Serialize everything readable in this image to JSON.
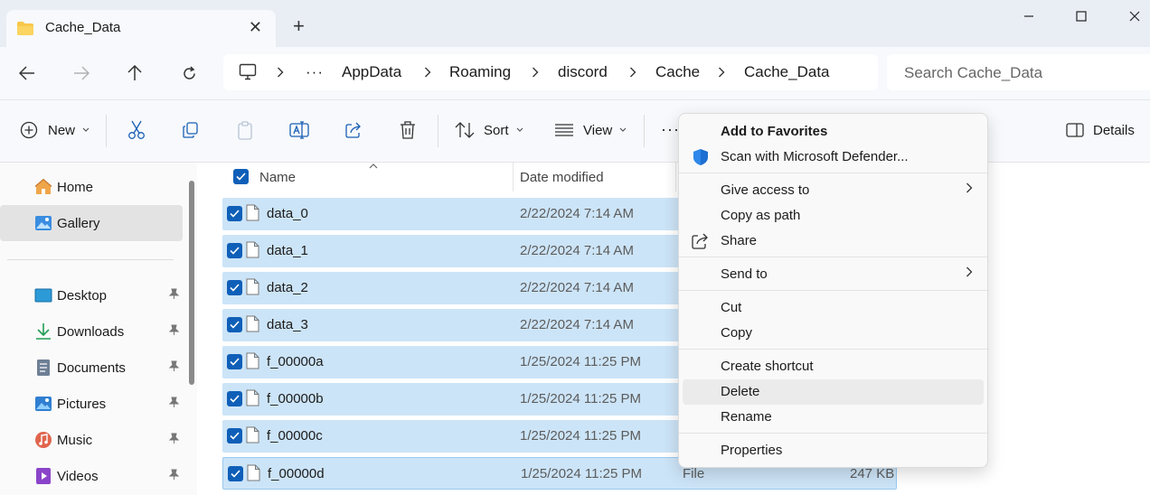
{
  "window": {
    "tab_title": "Cache_Data",
    "new_tab": "+",
    "controls": {
      "minimize": "—",
      "maximize": "☐",
      "close": "✕"
    }
  },
  "breadcrumb": {
    "overflow": "···",
    "items": [
      "AppData",
      "Roaming",
      "discord",
      "Cache",
      "Cache_Data"
    ]
  },
  "search": {
    "placeholder": "Search Cache_Data"
  },
  "toolbar": {
    "new_label": "New",
    "sort_label": "Sort",
    "view_label": "View",
    "more_label": "···",
    "details_label": "Details"
  },
  "nav": {
    "items": [
      {
        "label": "Home",
        "icon": "home-icon",
        "selected": false,
        "pinned": false
      },
      {
        "label": "Gallery",
        "icon": "gallery-icon",
        "selected": true,
        "pinned": false
      },
      {
        "label": "Desktop",
        "icon": "desktop-icon",
        "selected": false,
        "pinned": true
      },
      {
        "label": "Downloads",
        "icon": "download-icon",
        "selected": false,
        "pinned": true
      },
      {
        "label": "Documents",
        "icon": "documents-icon",
        "selected": false,
        "pinned": true
      },
      {
        "label": "Pictures",
        "icon": "pictures-icon",
        "selected": false,
        "pinned": true
      },
      {
        "label": "Music",
        "icon": "music-icon",
        "selected": false,
        "pinned": true
      },
      {
        "label": "Videos",
        "icon": "videos-icon",
        "selected": false,
        "pinned": true
      }
    ]
  },
  "columns": {
    "name": "Name",
    "date": "Date modified"
  },
  "files": [
    {
      "name": "data_0",
      "date": "2/22/2024 7:14 AM",
      "type": "",
      "size": ""
    },
    {
      "name": "data_1",
      "date": "2/22/2024 7:14 AM",
      "type": "",
      "size": ""
    },
    {
      "name": "data_2",
      "date": "2/22/2024 7:14 AM",
      "type": "",
      "size": ""
    },
    {
      "name": "data_3",
      "date": "2/22/2024 7:14 AM",
      "type": "",
      "size": ""
    },
    {
      "name": "f_00000a",
      "date": "1/25/2024 11:25 PM",
      "type": "",
      "size": ""
    },
    {
      "name": "f_00000b",
      "date": "1/25/2024 11:25 PM",
      "type": "",
      "size": ""
    },
    {
      "name": "f_00000c",
      "date": "1/25/2024 11:25 PM",
      "type": "",
      "size": ""
    },
    {
      "name": "f_00000d",
      "date": "1/25/2024 11:25 PM",
      "type": "File",
      "size": "247 KB"
    }
  ],
  "context_menu": {
    "add_favorites": "Add to Favorites",
    "scan_defender": "Scan with Microsoft Defender...",
    "give_access": "Give access to",
    "copy_path": "Copy as path",
    "share": "Share",
    "send_to": "Send to",
    "cut": "Cut",
    "copy": "Copy",
    "create_shortcut": "Create shortcut",
    "delete": "Delete",
    "rename": "Rename",
    "properties": "Properties"
  },
  "colors": {
    "accent": "#0f5fb8",
    "selection": "#cce4f7",
    "menu_hover": "#ebebeb"
  }
}
